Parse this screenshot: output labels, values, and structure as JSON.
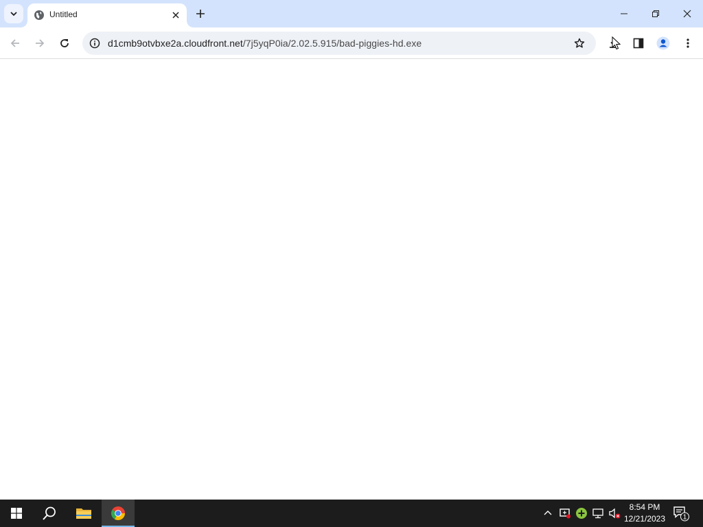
{
  "browser": {
    "tab": {
      "title": "Untitled"
    },
    "address": {
      "domain": "d1cmb9otvbxe2a.cloudfront.net",
      "path": "/7j5yqP0ia/2.02.5.915/bad-piggies-hd.exe"
    }
  },
  "taskbar": {
    "clock": {
      "time": "8:54 PM",
      "date": "12/21/2023"
    },
    "notifications": {
      "count": "1"
    }
  },
  "colors": {
    "tabstrip": "#d3e3fd",
    "omnibox": "#eef1f6",
    "taskbar": "#1c1c1c",
    "accent": "#76b9ed"
  }
}
